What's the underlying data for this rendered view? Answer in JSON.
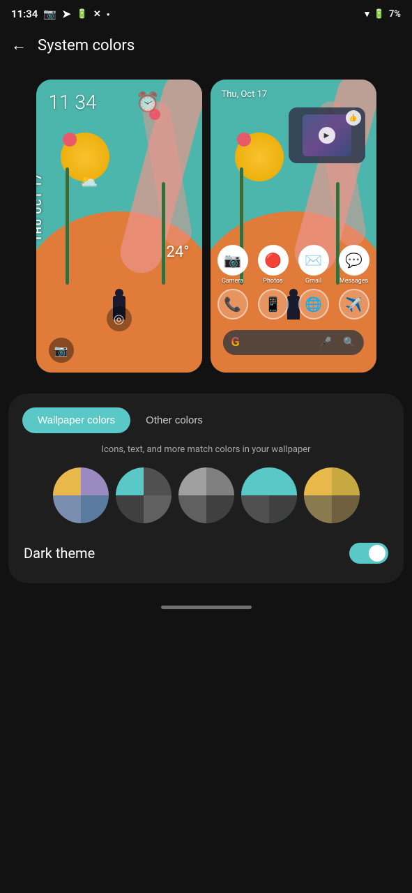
{
  "statusBar": {
    "time": "11:34",
    "battery": "7%",
    "icons": [
      "camera-icon",
      "telegram-icon",
      "battery-saver-icon",
      "x-icon",
      "dot-icon"
    ]
  },
  "header": {
    "backLabel": "←",
    "title": "System colors"
  },
  "lockScreen": {
    "time": "11 34",
    "date": "THU OCT 17",
    "temperature": "24°",
    "alarmIcon": "⏰"
  },
  "homeScreen": {
    "date": "Thu, Oct 17",
    "apps": [
      {
        "label": "Camera",
        "icon": "📷"
      },
      {
        "label": "Photos",
        "icon": "🔴"
      },
      {
        "label": "Gmail",
        "icon": "✉️"
      },
      {
        "label": "Messages",
        "icon": "💬"
      }
    ],
    "dockApps": [
      {
        "label": "Phone",
        "icon": "📞"
      },
      {
        "label": "WhatsApp",
        "icon": "📱"
      },
      {
        "label": "Chrome",
        "icon": "🌐"
      },
      {
        "label": "Telegram",
        "icon": "✈️"
      }
    ]
  },
  "bottomCard": {
    "tabs": [
      {
        "label": "Wallpaper colors",
        "active": true
      },
      {
        "label": "Other colors",
        "active": false
      }
    ],
    "description": "Icons, text, and more match colors in your wallpaper",
    "swatches": [
      {
        "id": "swatch1",
        "selected": false,
        "colors": {
          "q1": "#e8b84b",
          "q2": "#9b8abf",
          "q3": "#7a8faf",
          "q4": "#5a7a9f"
        }
      },
      {
        "id": "swatch2",
        "selected": false,
        "colors": {
          "q1": "#5bc8c8",
          "q2": "#505050",
          "q3": "#404040",
          "q4": "#606060"
        }
      },
      {
        "id": "swatch3",
        "selected": false,
        "colors": {
          "q1": "#a0a0a0",
          "q2": "#808080",
          "q3": "#606060",
          "q4": "#404040"
        }
      },
      {
        "id": "swatch4",
        "selected": true,
        "colors": {
          "q1": "#5bc8c8",
          "q2": "#5bc8c8",
          "q3": "#505050",
          "q4": "#404040"
        }
      },
      {
        "id": "swatch5",
        "selected": false,
        "colors": {
          "q1": "#e8b84b",
          "q2": "#c8a840",
          "q3": "#8a7a50",
          "q4": "#706040"
        }
      }
    ],
    "darkTheme": {
      "label": "Dark theme",
      "enabled": true
    }
  },
  "homeIndicator": {}
}
